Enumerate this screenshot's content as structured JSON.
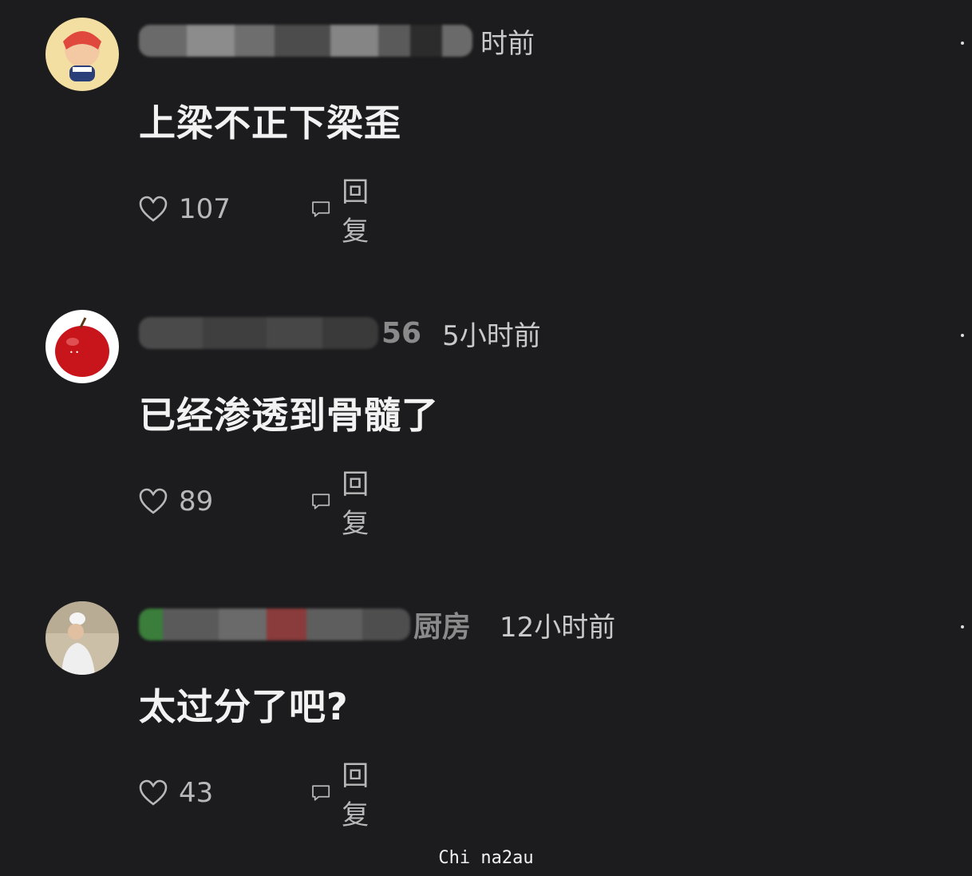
{
  "comments": [
    {
      "time": "时前",
      "text": "上梁不正下梁歪",
      "likes": "107",
      "reply_label": "回复",
      "avatar_icon": "cartoon-avatar-icon"
    },
    {
      "name_partial": "56",
      "time": "5小时前",
      "text": "已经渗透到骨髓了",
      "likes": "89",
      "reply_label": "回复",
      "avatar_icon": "apple-avatar-icon"
    },
    {
      "name_partial": "厨房",
      "time": "12小时前",
      "text": "太过分了吧?",
      "likes": "43",
      "reply_label": "回复",
      "avatar_icon": "person-avatar-icon"
    }
  ],
  "watermark": "Chi na2au",
  "colors": {
    "background": "#1c1c1e",
    "text": "#f2f2f2",
    "muted": "#b8b8b8"
  }
}
